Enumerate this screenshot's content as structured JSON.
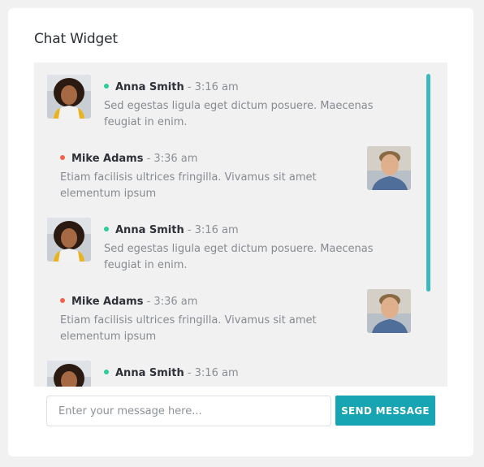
{
  "widget": {
    "title": "Chat Widget"
  },
  "messages": [
    {
      "side": "left",
      "status": "green",
      "name": "Anna Smith",
      "time": " - 3:16 am",
      "text": "Sed egestas ligula eget dictum posuere. Maecenas feugiat in enim."
    },
    {
      "side": "right",
      "status": "red",
      "name": "Mike Adams",
      "time": " - 3:36 am",
      "text": "Etiam facilisis ultrices fringilla. Vivamus sit amet elementum ipsum"
    },
    {
      "side": "left",
      "status": "green",
      "name": "Anna Smith",
      "time": " - 3:16 am",
      "text": "Sed egestas ligula eget dictum posuere. Maecenas feugiat in enim."
    },
    {
      "side": "right",
      "status": "red",
      "name": "Mike Adams",
      "time": " - 3:36 am",
      "text": "Etiam facilisis ultrices fringilla. Vivamus sit amet elementum ipsum"
    },
    {
      "side": "left",
      "status": "green",
      "name": "Anna Smith",
      "time": " - 3:16 am",
      "text": ""
    }
  ],
  "composer": {
    "placeholder": "Enter your message here...",
    "value": "",
    "send_label": "SEND MESSAGE"
  },
  "colors": {
    "accent": "#17a5b4",
    "scrollbar": "#3db8c0",
    "online": "#2ecc9a",
    "away": "#f0624b"
  },
  "icons": {
    "anna_avatar": "avatar-woman-icon",
    "mike_avatar": "avatar-man-icon"
  }
}
